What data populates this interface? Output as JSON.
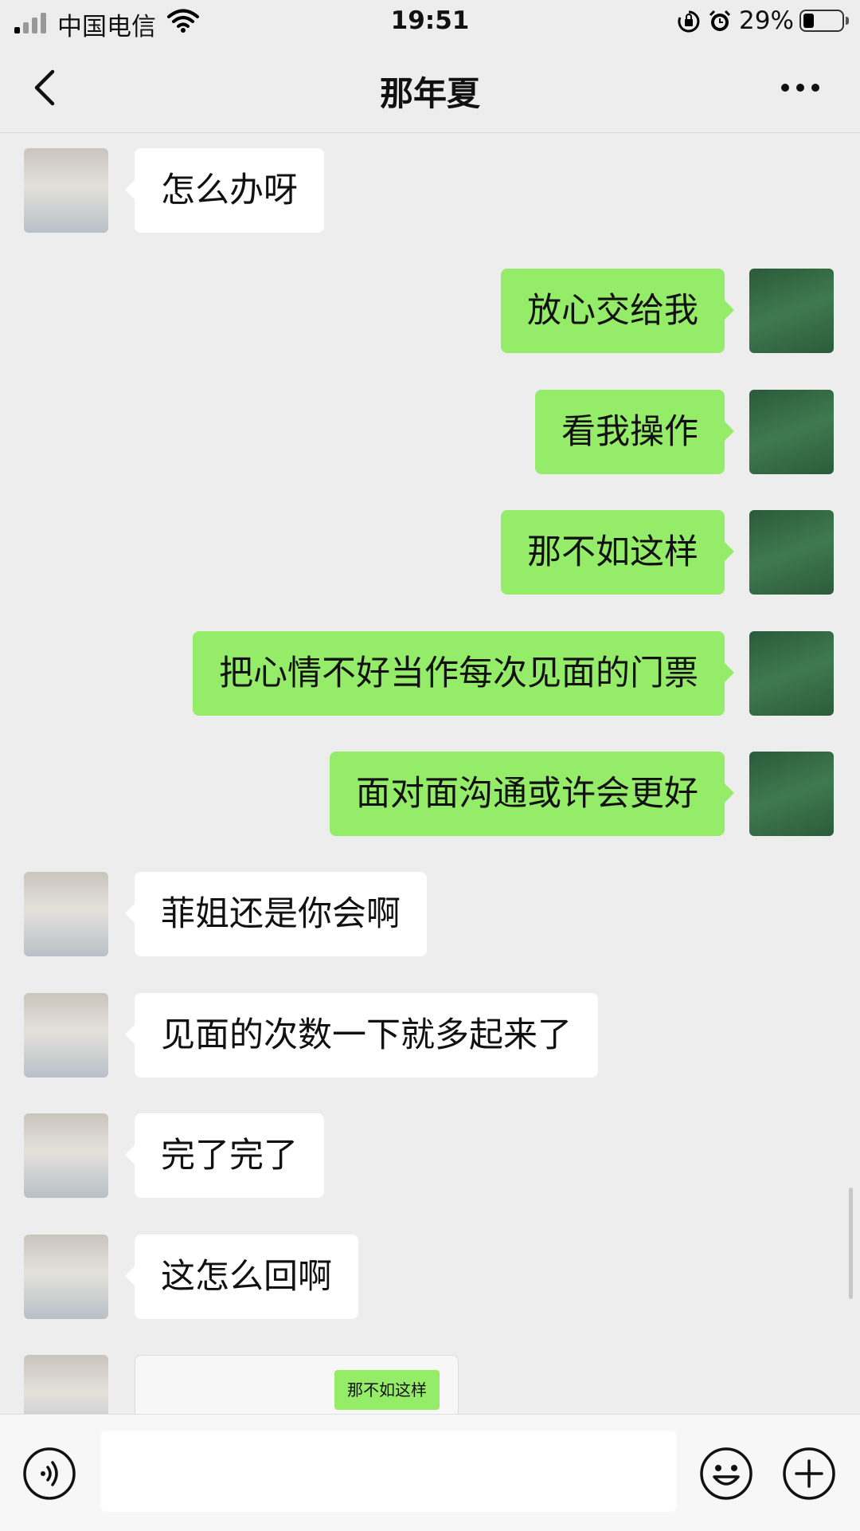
{
  "status_bar": {
    "carrier": "中国电信",
    "time": "19:51",
    "battery_pct": "29%"
  },
  "nav": {
    "title": "那年夏"
  },
  "messages": [
    {
      "side": "left",
      "text": "怎么办呀"
    },
    {
      "side": "right",
      "text": "放心交给我"
    },
    {
      "side": "right",
      "text": "看我操作"
    },
    {
      "side": "right",
      "text": "那不如这样"
    },
    {
      "side": "right",
      "text": "把心情不好当作每次见面的门票"
    },
    {
      "side": "right",
      "text": "面对面沟通或许会更好"
    },
    {
      "side": "left",
      "text": "菲姐还是你会啊"
    },
    {
      "side": "left",
      "text": "见面的次数一下就多起来了"
    },
    {
      "side": "left",
      "text": "完了完了"
    },
    {
      "side": "left",
      "text": "这怎么回啊"
    }
  ],
  "quoted_card": {
    "text": "那不如这样"
  },
  "input_bar": {
    "value": ""
  },
  "colors": {
    "sent_bubble": "#95ec69",
    "received_bubble": "#ffffff",
    "background": "#ededed"
  },
  "icons": [
    "signal-icon",
    "wifi-icon",
    "orientation-lock-icon",
    "alarm-icon",
    "battery-icon",
    "back-chevron-icon",
    "more-icon",
    "voice-icon",
    "emoji-icon",
    "plus-icon"
  ]
}
